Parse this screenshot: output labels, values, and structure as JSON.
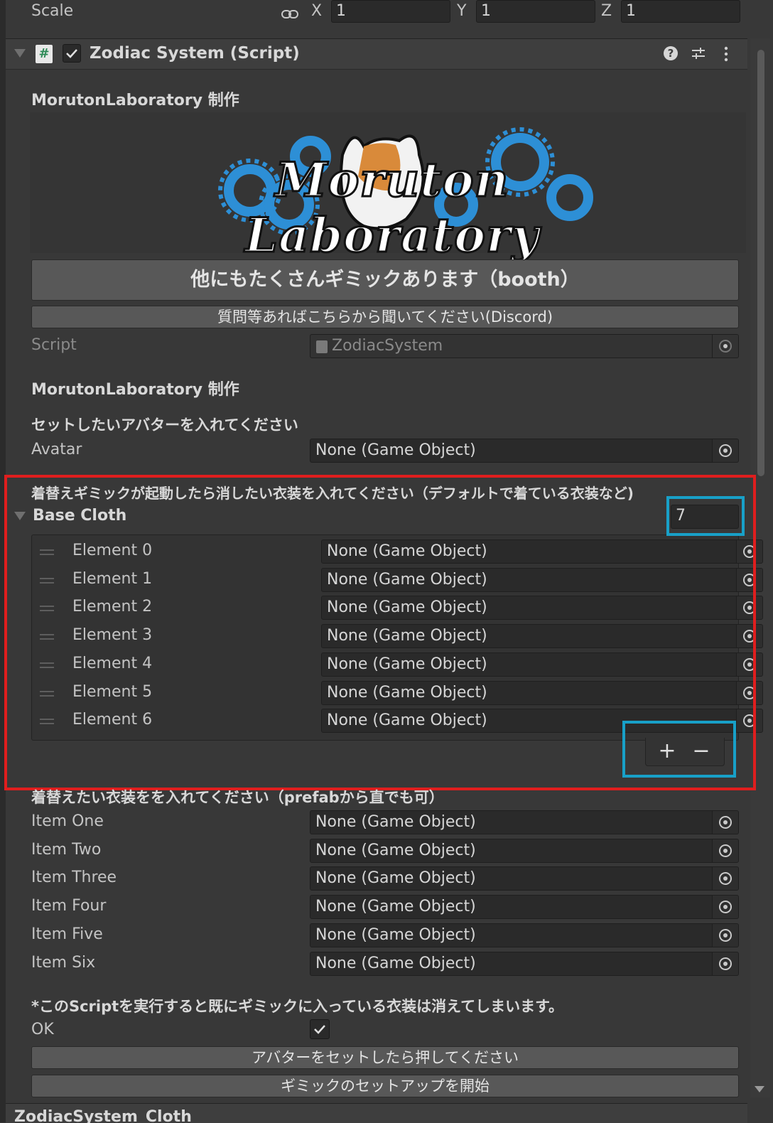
{
  "transform": {
    "scale_label": "Scale",
    "x_label": "X",
    "x_value": "1",
    "y_label": "Y",
    "y_value": "1",
    "z_label": "Z",
    "z_value": "1"
  },
  "component": {
    "title": "Zodiac System (Script)",
    "enabled": true
  },
  "header": {
    "credit": "MorutonLaboratory 制作",
    "logo_text": "Moruton Laboratory",
    "booth_button": "他にもたくさんギミックあります（booth）",
    "discord_button": "質問等あればこちらから聞いてください(Discord)"
  },
  "script_field": {
    "label": "Script",
    "value": "ZodiacSystem"
  },
  "credit2": "MorutonLaboratory 制作",
  "avatar_section": {
    "instruction": "セットしたいアバターを入れてください",
    "label": "Avatar",
    "value": "None (Game Object)"
  },
  "base_cloth": {
    "instruction": "着替えギミックが起動したら消したい衣装を入れてください（デフォルトで着ている衣装など)",
    "label": "Base Cloth",
    "size": "7",
    "elements": [
      {
        "label": "Element 0",
        "value": "None (Game Object)"
      },
      {
        "label": "Element 1",
        "value": "None (Game Object)"
      },
      {
        "label": "Element 2",
        "value": "None (Game Object)"
      },
      {
        "label": "Element 3",
        "value": "None (Game Object)"
      },
      {
        "label": "Element 4",
        "value": "None (Game Object)"
      },
      {
        "label": "Element 5",
        "value": "None (Game Object)"
      },
      {
        "label": "Element 6",
        "value": "None (Game Object)"
      }
    ],
    "add_label": "+",
    "remove_label": "−"
  },
  "items_section": {
    "instruction": "着替えたい衣装をを入れてください（prefabから直でも可）",
    "items": [
      {
        "label": "Item One",
        "value": "None (Game Object)"
      },
      {
        "label": "Item Two",
        "value": "None (Game Object)"
      },
      {
        "label": "Item Three",
        "value": "None (Game Object)"
      },
      {
        "label": "Item Four",
        "value": "None (Game Object)"
      },
      {
        "label": "Item Five",
        "value": "None (Game Object)"
      },
      {
        "label": "Item Six",
        "value": "None (Game Object)"
      }
    ]
  },
  "footer": {
    "warning": "*このScriptを実行すると既にギミックに入っている衣装は消えてしまいます。",
    "ok_label": "OK",
    "ok_checked": true,
    "set_avatar_button": "アバターをセットしたら押してください",
    "setup_button": "ギミックのセットアップを開始",
    "next_component": "ZodiacSystem_Cloth"
  },
  "colors": {
    "background": "#383838",
    "field": "#2a2a2a",
    "button": "#585858",
    "highlight_red": "#e01e1e",
    "highlight_blue": "#18a0c8"
  }
}
